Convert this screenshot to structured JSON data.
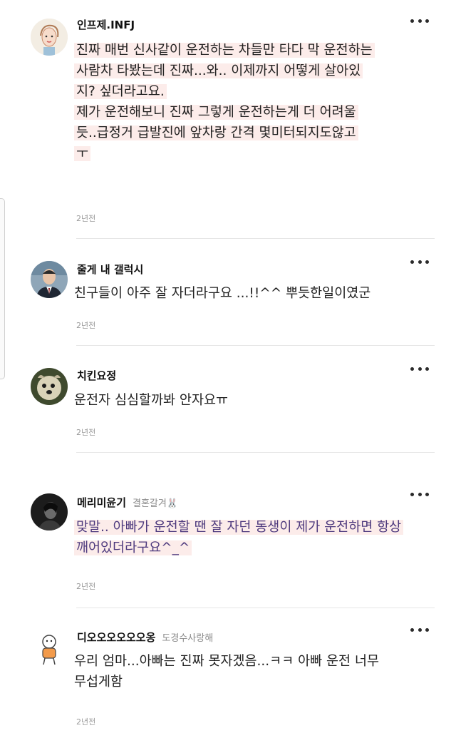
{
  "comments": [
    {
      "nickname": "인프제.INFJ",
      "badge": "",
      "lines": [
        "진짜 매번 신사같이 운전하는 차들만 타다 막 운전하는",
        "사람차 타봤는데 진짜...와.. 이제까지 어떻게 살아있",
        "지? 싶더라고요.",
        "제가 운전해보니 진짜 그렇게 운전하는게 더 어려울",
        "듯..급정거 급발진에 앞차랑 간격 몇미터되지도않고",
        "ㅜ"
      ],
      "time": "2년전",
      "avatar_icon": "woman-illustration-avatar",
      "highlighted": true
    },
    {
      "nickname": "줄게 내 갤럭시",
      "badge": "",
      "lines": [
        "친구들이 아주 잘 자더라구요 ...!!^^ 뿌듯한일이였군"
      ],
      "time": "2년전",
      "avatar_icon": "businessman-photo-avatar",
      "avatar_level": "5"
    },
    {
      "nickname": "치킨요정",
      "badge": "",
      "lines": [
        "운전자 심심할까봐 안자요ㅠ"
      ],
      "time": "2년전",
      "avatar_icon": "dog-photo-avatar"
    },
    {
      "nickname": "메리미윤기",
      "badge": "결혼갈겨🐰",
      "lines": [
        "맞말.. 아빠가 운전할 땐 잘 자던 동생이 제가 운전하면 항상",
        "깨어있더라구요^_^"
      ],
      "time": "2년전",
      "avatar_icon": "dark-photo-avatar",
      "avatar_level": "2",
      "highlighted": true,
      "text_color": "#4e3a7e"
    },
    {
      "nickname": "디오오오오오오옹",
      "badge": "도경수사랑해",
      "lines": [
        "우리 엄마...아빠는 진짜 못자겠음...ㅋㅋ 아빠 운전 너무",
        "무섭게함"
      ],
      "time": "2년전",
      "avatar_icon": "cartoon-character-avatar",
      "avatar_level": "B"
    }
  ]
}
